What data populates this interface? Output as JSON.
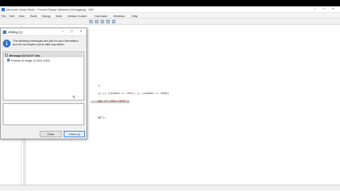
{
  "ide": {
    "title": "Microsoft Visual Studio - Product Range Validation [Debugging] - VBS",
    "menu": [
      "File",
      "Edit",
      "View",
      "Build",
      "Debug",
      "Tools",
      "Version Control",
      "Command",
      "Windows",
      "Help"
    ],
    "code_lines": [
      {
        "pre": "    );",
        "str": "",
        "post": ""
      },
      {
        "pre": "    )) || (itemId == ",
        "str": "1001",
        "post": ") || (itemId == 1003)"
      },
      {
        "pre": "    ",
        "str": "nge of 1001-1003\");",
        "post": ""
      },
      {
        "pre": "    ",
        "str": "",
        "post": "ng\");"
      }
    ]
  },
  "dialog": {
    "title": "VbMsg (1)",
    "info_text": "The following messages are just for your information and do not require you to take any action.",
    "message_header": "Message (02:32:27 am)",
    "toggle_glyph": "−",
    "message_item": "Product in range of 1001-1003",
    "buttons": {
      "clear": "Clear",
      "close": "Close (c)"
    }
  },
  "colors": {
    "string": "#a31515",
    "info_icon": "#2f6fc4",
    "primary_border": "#3c7fd6"
  }
}
